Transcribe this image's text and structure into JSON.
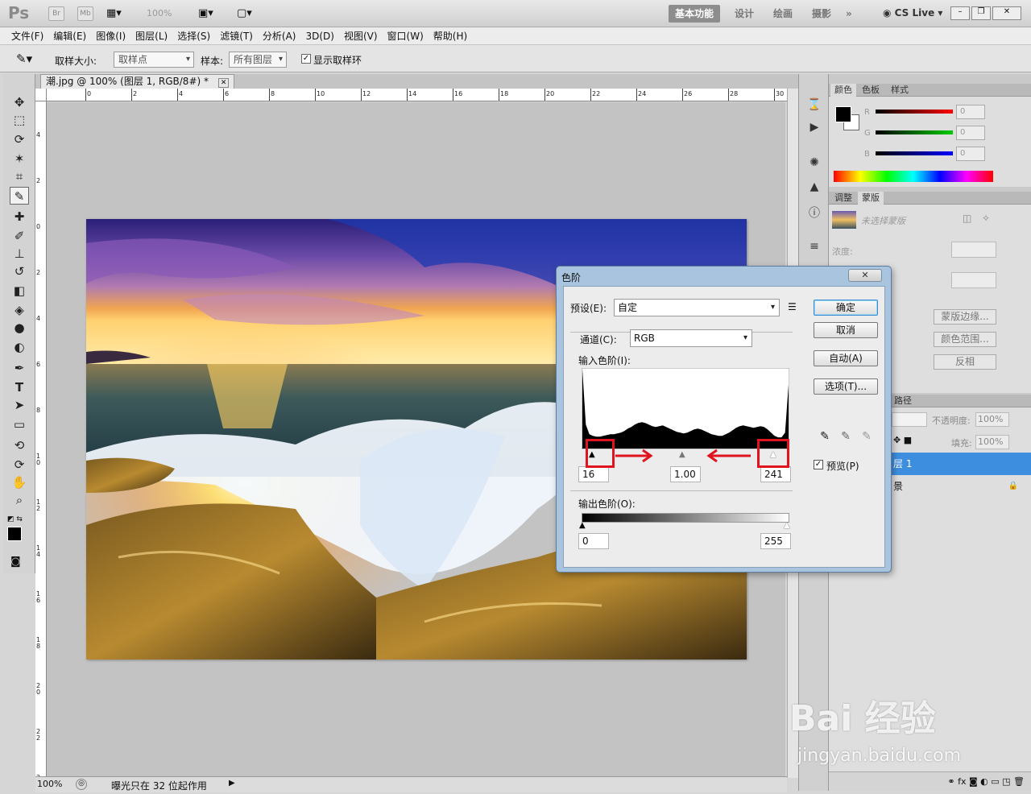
{
  "app": {
    "logo": "Ps",
    "br_label": "Br",
    "mb_label": "Mb",
    "zoom_display": "100%"
  },
  "workspace": {
    "items": [
      "基本功能",
      "设计",
      "绘画",
      "摄影"
    ],
    "more": "»",
    "cslive": "CS Live"
  },
  "menu": [
    "文件(F)",
    "编辑(E)",
    "图像(I)",
    "图层(L)",
    "选择(S)",
    "滤镜(T)",
    "分析(A)",
    "3D(D)",
    "视图(V)",
    "窗口(W)",
    "帮助(H)"
  ],
  "options": {
    "sample_size_label": "取样大小:",
    "sample_size_value": "取样点",
    "sample_label": "样本:",
    "sample_value": "所有图层",
    "show_ring_label": "显示取样环",
    "show_ring_checked": true
  },
  "document": {
    "tab_title": "潮.jpg @ 100% (图层 1, RGB/8#) *",
    "close": "✕"
  },
  "rulers": {
    "h_ticks": [
      "0",
      "2",
      "4",
      "6",
      "8",
      "10",
      "12",
      "14",
      "16",
      "18",
      "20",
      "22",
      "24",
      "26",
      "28",
      "30"
    ],
    "v_ticks": [
      "4",
      "2",
      "0",
      "2",
      "4",
      "6",
      "8",
      "1 0",
      "1 2",
      "1 4",
      "1 6",
      "1 8",
      "2 0",
      "2 2",
      "2 4"
    ]
  },
  "status": {
    "zoom": "100%",
    "message": "曝光只在 32 位起作用"
  },
  "color_panel": {
    "tabs": [
      "颜色",
      "色板",
      "样式"
    ],
    "r_label": "R",
    "g_label": "G",
    "b_label": "B",
    "r": "0",
    "g": "0",
    "b": "0"
  },
  "mask_panel": {
    "tabs": [
      "调整",
      "蒙版"
    ],
    "no_mask": "未选择蒙版",
    "density_label": "浓度:",
    "edge_btn": "蒙版边缘...",
    "range_btn": "颜色范围...",
    "invert_btn": "反相"
  },
  "layers_panel": {
    "tab_fragment": "路径",
    "opacity_label": "不透明度:",
    "opacity_value": "100%",
    "fill_label": "填充:",
    "fill_value": "100%",
    "layer1": "层 1",
    "background": "景"
  },
  "watermark": {
    "brand": "Bai 经验",
    "url": "jingyan.baidu.com"
  },
  "levels_dialog": {
    "title": "色阶",
    "close": "✕",
    "preset_label": "预设(E):",
    "preset_value": "自定",
    "channel_label": "通道(C):",
    "channel_value": "RGB",
    "input_label": "输入色阶(I):",
    "input_black": "16",
    "input_mid": "1.00",
    "input_white": "241",
    "output_label": "输出色阶(O):",
    "output_black": "0",
    "output_white": "255",
    "ok": "确定",
    "cancel": "取消",
    "auto": "自动(A)",
    "options": "选项(T)...",
    "preview_label": "预览(P)",
    "preview_checked": true,
    "highlight_color": "#e0141e",
    "histogram": [
      1.0,
      0.3,
      0.18,
      0.16,
      0.15,
      0.15,
      0.16,
      0.17,
      0.18,
      0.18,
      0.19,
      0.2,
      0.22,
      0.25,
      0.27,
      0.3,
      0.32,
      0.33,
      0.32,
      0.3,
      0.28,
      0.27,
      0.28,
      0.29,
      0.27,
      0.25,
      0.23,
      0.21,
      0.2,
      0.19,
      0.2,
      0.22,
      0.24,
      0.25,
      0.24,
      0.22,
      0.2,
      0.18,
      0.17,
      0.16,
      0.16,
      0.18,
      0.2,
      0.23,
      0.26,
      0.28,
      0.29,
      0.28,
      0.27,
      0.26,
      0.27,
      0.28,
      0.27,
      0.24,
      0.2,
      0.16,
      0.14,
      0.14,
      0.2,
      0.8
    ]
  }
}
